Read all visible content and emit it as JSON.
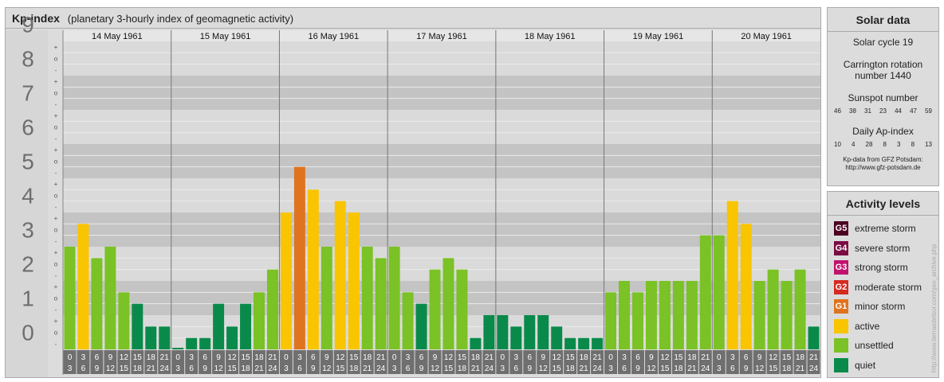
{
  "header": {
    "title": "Kp-index",
    "subtitle": "(planetary 3-hourly index of geomagnetic activity)"
  },
  "chart_data": {
    "type": "bar",
    "title": "Kp-index",
    "ylim": [
      0,
      9
    ],
    "y_ticks": [
      "0",
      "1",
      "2",
      "3",
      "4",
      "5",
      "6",
      "7",
      "8",
      "9"
    ],
    "y_minor_ticks": [
      "+",
      "o",
      "-"
    ],
    "days": [
      "14 May 1961",
      "15 May 1961",
      "16 May 1961",
      "17 May 1961",
      "18 May 1961",
      "19 May 1961",
      "20 May 1961"
    ],
    "interval_labels": [
      [
        "0",
        "3"
      ],
      [
        "3",
        "6"
      ],
      [
        "6",
        "9"
      ],
      [
        "9",
        "12"
      ],
      [
        "12",
        "15"
      ],
      [
        "15",
        "18"
      ],
      [
        "18",
        "21"
      ],
      [
        "21",
        "24"
      ]
    ],
    "values": [
      [
        3.0,
        3.667,
        2.667,
        3.0,
        1.667,
        1.333,
        0.667,
        0.667
      ],
      [
        0.0,
        0.333,
        0.333,
        1.333,
        0.667,
        1.333,
        1.667,
        2.333
      ],
      [
        4.0,
        5.333,
        4.667,
        3.0,
        4.333,
        4.0,
        3.0,
        2.667
      ],
      [
        3.0,
        1.667,
        1.333,
        2.333,
        2.667,
        2.333,
        0.333,
        1.0
      ],
      [
        1.0,
        0.667,
        1.0,
        1.0,
        0.667,
        0.333,
        0.333,
        0.333
      ],
      [
        1.667,
        2.0,
        1.667,
        2.0,
        2.0,
        2.0,
        2.0,
        3.333
      ],
      [
        3.333,
        4.333,
        3.667,
        2.0,
        2.333,
        2.0,
        2.333,
        0.667
      ]
    ],
    "grid": true
  },
  "solar": {
    "title": "Solar data",
    "cycle": "Solar cycle 19",
    "carrington_line1": "Carrington rotation",
    "carrington_line2": "number 1440",
    "sunspot_label": "Sunspot number",
    "sunspot_numbers": [
      "46",
      "38",
      "31",
      "23",
      "44",
      "47",
      "59"
    ],
    "ap_label": "Daily Ap-index",
    "ap_values": [
      "10",
      "4",
      "28",
      "8",
      "3",
      "8",
      "13"
    ],
    "credit_line1": "Kp-data from GFZ Potsdam:",
    "credit_line2": "http://www.gfz-potsdam.de"
  },
  "levels": {
    "title": "Activity levels",
    "items": [
      {
        "code": "G5",
        "label": "extreme storm",
        "color": "#4d0020"
      },
      {
        "code": "G4",
        "label": "severe storm",
        "color": "#7a0c44"
      },
      {
        "code": "G3",
        "label": "strong storm",
        "color": "#c0136e"
      },
      {
        "code": "G2",
        "label": "moderate storm",
        "color": "#d42a20"
      },
      {
        "code": "G1",
        "label": "minor storm",
        "color": "#e0731e"
      },
      {
        "code": "",
        "label": "active",
        "color": "#f9c400"
      },
      {
        "code": "",
        "label": "unsettled",
        "color": "#7ac225"
      },
      {
        "code": "",
        "label": "quiet",
        "color": "#0a8a4a"
      }
    ]
  },
  "watermark": "http://www.tierrasdelsur.com/geo_archive.php"
}
